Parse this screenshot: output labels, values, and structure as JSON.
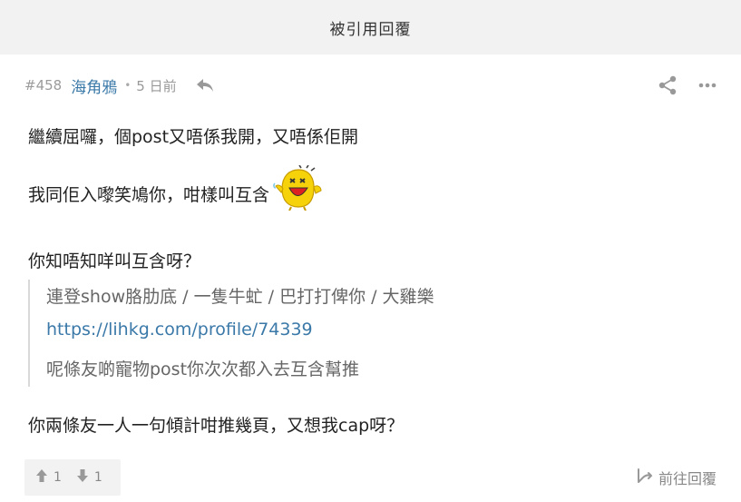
{
  "header": {
    "title": "被引用回覆"
  },
  "post": {
    "number": "#458",
    "username": "海角鴉",
    "separator": "•",
    "time": "5 日前",
    "lines": {
      "first": "繼續屈囉，個post又唔係我開，又唔係佢開",
      "second": "我同佢入嚟笑鳩你，咁樣叫互含",
      "third": "你知唔知咩叫互含呀？",
      "last": "你兩條友一人一句傾計咁推幾頁，又想我cap呀？"
    },
    "quote": {
      "line1": "連登show胳肋底 / 一隻牛虻 / 巴打打俾你 / 大雞樂",
      "link": "https://lihkg.com/profile/74339",
      "line3": "呢條友啲寵物post你次次都入去互含幫推"
    },
    "votes": {
      "up": "1",
      "down": "1"
    },
    "reply_label": "前往回覆"
  },
  "icons": {
    "reply": "reply-arrow-icon",
    "share": "share-icon",
    "more": "more-dots-icon",
    "upvote": "thumbs-up-arrow-icon",
    "downvote": "thumbs-down-arrow-icon",
    "goto_reply": "goto-reply-icon",
    "emoji": "laughing-yellow-emoji-icon"
  },
  "colors": {
    "accent": "#3a79a8",
    "header_bg": "#f2f2f2",
    "muted": "#999999",
    "emoji_yellow": "#f5d20a"
  }
}
